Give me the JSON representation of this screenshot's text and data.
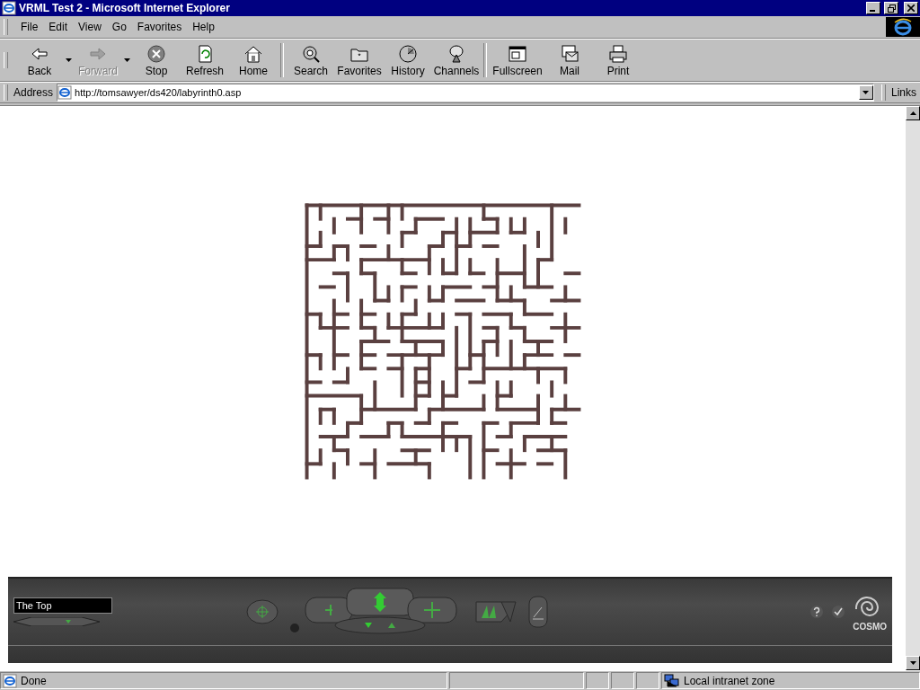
{
  "window": {
    "title": "VRML Test 2 - Microsoft Internet Explorer"
  },
  "menu": [
    "File",
    "Edit",
    "View",
    "Go",
    "Favorites",
    "Help"
  ],
  "toolbar": [
    {
      "kind": "back",
      "label": "Back",
      "disabled": false,
      "dropdown": true
    },
    {
      "kind": "forward",
      "label": "Forward",
      "disabled": true,
      "dropdown": true
    },
    {
      "kind": "stop",
      "label": "Stop",
      "disabled": false,
      "dropdown": false
    },
    {
      "kind": "refresh",
      "label": "Refresh",
      "disabled": false,
      "dropdown": false
    },
    {
      "kind": "home",
      "label": "Home",
      "disabled": false,
      "dropdown": false
    },
    {
      "kind": "search",
      "label": "Search",
      "disabled": false,
      "dropdown": false
    },
    {
      "kind": "favorites",
      "label": "Favorites",
      "disabled": false,
      "dropdown": false
    },
    {
      "kind": "history",
      "label": "History",
      "disabled": false,
      "dropdown": false
    },
    {
      "kind": "channels",
      "label": "Channels",
      "disabled": false,
      "dropdown": false
    },
    {
      "kind": "fullscreen",
      "label": "Fullscreen",
      "disabled": false,
      "dropdown": false
    },
    {
      "kind": "mail",
      "label": "Mail",
      "disabled": false,
      "dropdown": false
    },
    {
      "kind": "print",
      "label": "Print",
      "disabled": false,
      "dropdown": false
    }
  ],
  "address": {
    "label": "Address",
    "value": "http://tomsawyer/ds420/labyrinth0.asp",
    "links": "Links"
  },
  "player": {
    "viewpoint": "The Top",
    "logo": "COSMO"
  },
  "status_bar": {
    "text": "Done",
    "zone": "Local intranet zone"
  }
}
